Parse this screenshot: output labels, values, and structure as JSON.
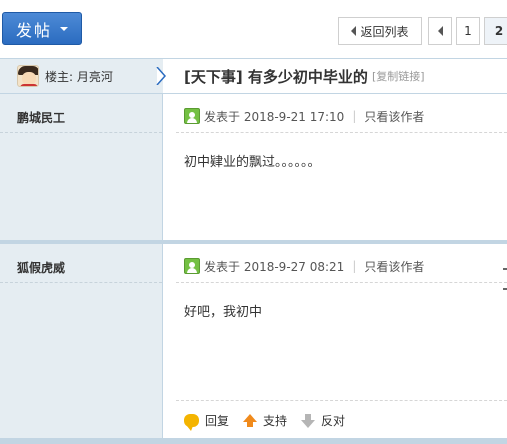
{
  "toolbar": {
    "post_button": "发帖",
    "back_to_list": "返回列表",
    "page_1": "1",
    "page_2": "2"
  },
  "thread": {
    "host_label": "楼主: 月亮河",
    "title": "[天下事] 有多少初中毕业的",
    "copy_link": "[复制链接]"
  },
  "posts": [
    {
      "author": "鹏城民工",
      "posted_at": "发表于 2018-9-21 17:10",
      "view_author": "只看该作者",
      "content": "初中肄业的飘过。。。。。。"
    },
    {
      "author": "狐假虎威",
      "posted_at": "发表于 2018-9-27 08:21",
      "view_author": "只看该作者",
      "content": "好吧，我初中",
      "actions": {
        "reply": "回复",
        "support": "支持",
        "oppose": "反对"
      }
    }
  ],
  "colors": {
    "side_bg": "#e5edf2",
    "border": "#c2d5e3",
    "post_button": "#2b6cc0",
    "online_icon": "#74c043",
    "support_icon": "#f08a1c"
  }
}
